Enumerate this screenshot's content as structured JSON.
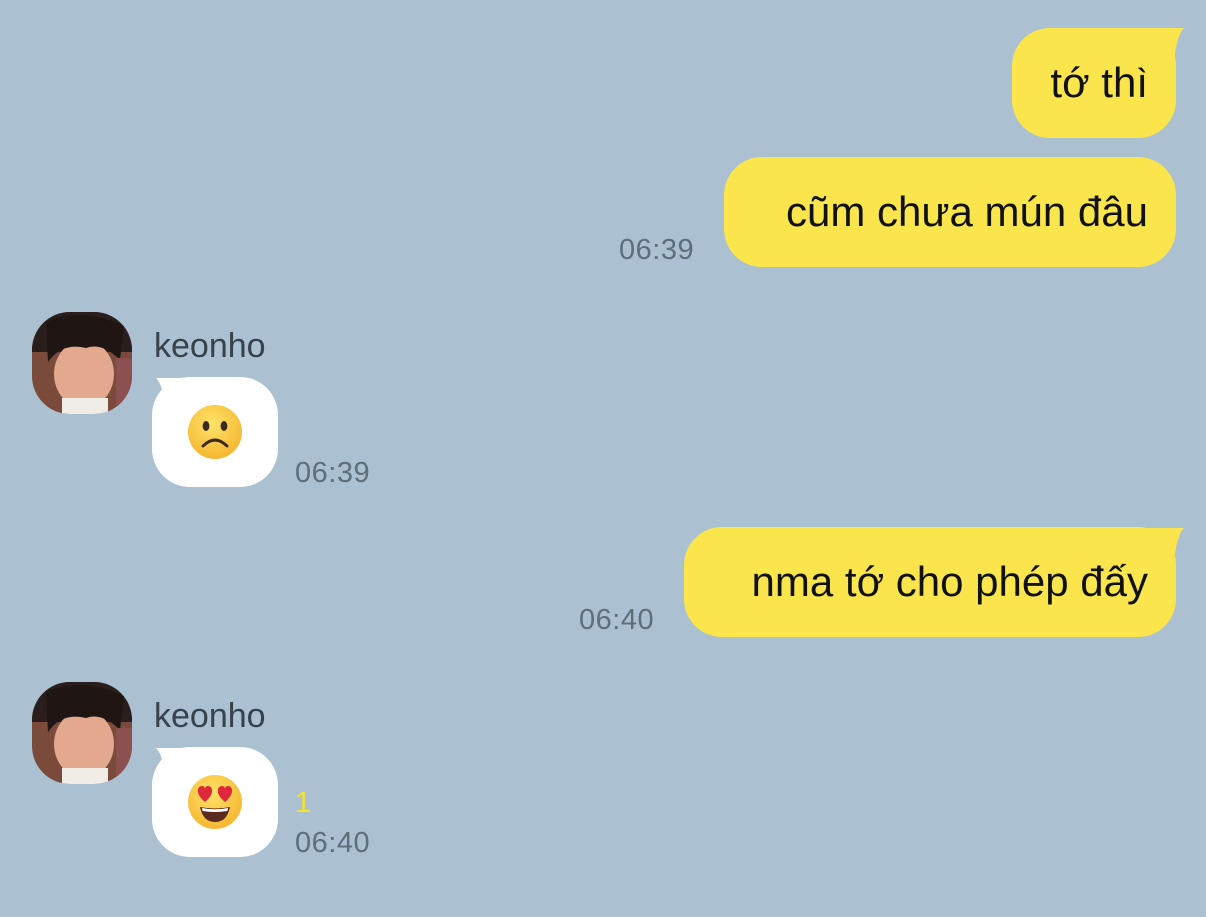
{
  "chat": {
    "messages": [
      {
        "direction": "outgoing",
        "text": "tớ thì"
      },
      {
        "direction": "outgoing",
        "text": "cũm chưa mún đâu",
        "time": "06:39"
      },
      {
        "direction": "incoming",
        "sender": "keonho",
        "emoji": "frowning-face",
        "time": "06:39"
      },
      {
        "direction": "outgoing",
        "text": "nma tớ cho phép đấy",
        "time": "06:40"
      },
      {
        "direction": "incoming",
        "sender": "keonho",
        "emoji": "heart-eyes-face",
        "unread_count": "1",
        "time": "06:40"
      }
    ]
  },
  "colors": {
    "background": "#abc1d1",
    "outgoing_bubble": "#fae64c",
    "incoming_bubble": "#ffffff",
    "unread_count": "#f5e22d",
    "timestamp": "#5e6e7a"
  }
}
